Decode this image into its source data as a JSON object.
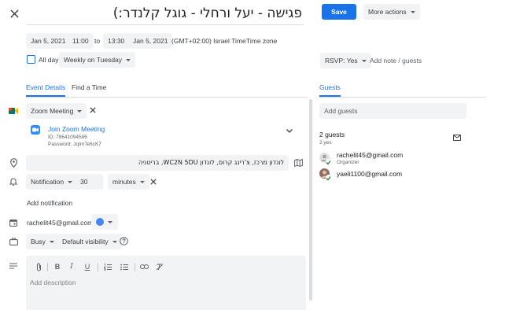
{
  "header": {
    "title": "פגישה - יעל ורחלי - גוגל קלנדר:)",
    "save_label": "Save",
    "more_actions_label": "More actions"
  },
  "datetime": {
    "start_date": "Jan 5, 2021",
    "start_time": "11:00",
    "to_label": "to",
    "end_time": "13:30",
    "end_date": "Jan 5, 2021",
    "timezone_value": "(GMT+02:00) Israel Time",
    "timezone_link": "Time zone",
    "all_day_label": "All day",
    "repeat_value": "Weekly on Tuesday"
  },
  "rsvp": {
    "value": "RSVP: Yes",
    "add_note_label": "Add note / guests"
  },
  "tabs": {
    "event_details": "Event Details",
    "find_time": "Find a Time",
    "guests": "Guests"
  },
  "conference": {
    "type": "Zoom Meeting",
    "join_label": "Join Zoom Meeting",
    "id_text": "ID: 78641094585",
    "password_text": "Password: JqImTe6cK7"
  },
  "location": {
    "value": "לונדון מרכז, צ'רינג קרוס, לונדון WC2N 5DU, בריטניה"
  },
  "notification": {
    "type": "Notification",
    "amount": "30",
    "unit": "minutes",
    "add_label": "Add notification"
  },
  "calendar": {
    "owner": "rachelit45@gmail.com",
    "color": "#4285f4"
  },
  "status": {
    "busy": "Busy",
    "visibility": "Default visibility"
  },
  "description": {
    "placeholder": "Add description"
  },
  "guests": {
    "add_placeholder": "Add guests",
    "count_label": "2 guests",
    "yes_label": "2 yes",
    "list": [
      {
        "email": "rachelit45@gmail.com",
        "role": "Organizer"
      },
      {
        "email": "yaeli1100@gmail.com",
        "role": ""
      }
    ]
  },
  "colors": {
    "primary": "#1a73e8",
    "accent_green": "#188038"
  }
}
